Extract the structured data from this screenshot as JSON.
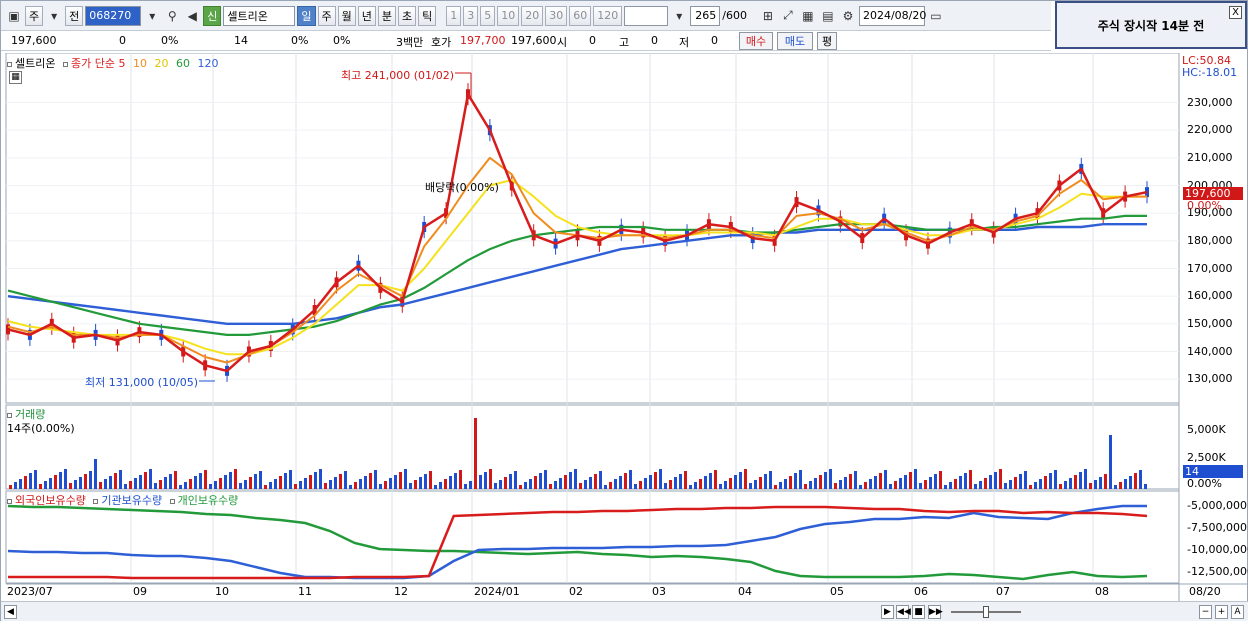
{
  "toolbar": {
    "menu1": "주",
    "menu2": "전",
    "code": "068270",
    "new_badge": "신",
    "stock_name": "셀트리온",
    "periods": [
      "일",
      "주",
      "월",
      "년",
      "분",
      "초",
      "틱"
    ],
    "intervals": [
      "1",
      "3",
      "5",
      "10",
      "20",
      "30",
      "60",
      "120"
    ],
    "count": "265",
    "count_max": "/600",
    "date": "2024/08/20"
  },
  "alert": {
    "text": "주식 장시작 14분 전",
    "close": "X"
  },
  "quote": {
    "price": "197,600",
    "change": "0",
    "change_pct": "0%",
    "volume": "14",
    "vol_pct1": "0%",
    "vol_pct2": "0%",
    "amount": "3백만",
    "ask_label": "호가",
    "ask": "197,700",
    "bid": "197,600",
    "open_label": "시",
    "open": "0",
    "high_label": "고",
    "high": "0",
    "low_label": "저",
    "low": "0",
    "buy": "매수",
    "sell": "매도",
    "eval": "평"
  },
  "chart_legend": {
    "stock": "셀트리온",
    "ma_label": "종가 단순",
    "ma5": "5",
    "ma10": "10",
    "ma20": "20",
    "ma60": "60",
    "ma120": "120",
    "lc": "LC:50.84",
    "hc": "HC:-18.01"
  },
  "annotations": {
    "high": "최고 241,000 (01/02)",
    "low": "최저 131,000 (10/05)",
    "dividend": "배당락(0.00%)"
  },
  "price_axis": [
    "230,000",
    "220,000",
    "210,000",
    "200,000",
    "190,000",
    "180,000",
    "170,000",
    "160,000",
    "150,000",
    "140,000",
    "130,000"
  ],
  "current_price_tag": "197,600",
  "current_pct_tag": "0.00%",
  "volume_panel": {
    "title": "거래량",
    "value": "14주(0.00%)",
    "axis": [
      "5,000K",
      "2,500K",
      "0.00%"
    ],
    "current": "14"
  },
  "holdings_panel": {
    "series": [
      "외국인보유수량",
      "기관보유수량",
      "개인보유수량"
    ],
    "axis": [
      "-5,000,000",
      "-7,500,000",
      "-10,000,000",
      "-12,500,000"
    ]
  },
  "date_axis": [
    "2023/07",
    "09",
    "10",
    "11",
    "12",
    "2024/01",
    "02",
    "03",
    "04",
    "05",
    "06",
    "07",
    "08",
    "08/20"
  ],
  "colors": {
    "ma5": "#d81c1c",
    "ma10": "#f08c1e",
    "ma20": "#f5e11c",
    "ma60": "#229a3a",
    "ma120": "#2f5fd6",
    "up": "#d01818",
    "down": "#1f4fd0"
  },
  "chart_data": [
    {
      "type": "line",
      "title": "셀트리온",
      "series": [
        {
          "name": "5",
          "values": [
            148000,
            146000,
            150000,
            145000,
            146000,
            144000,
            147000,
            146000,
            140000,
            135000,
            133000,
            140000,
            142000,
            148000,
            155000,
            165000,
            171000,
            163000,
            158000,
            185000,
            190000,
            233000,
            220000,
            200000,
            182000,
            179000,
            182000,
            180000,
            184000,
            183000,
            180000,
            182000,
            186000,
            185000,
            181000,
            180000,
            194000,
            191000,
            187000,
            181000,
            188000,
            182000,
            179000,
            183000,
            186000,
            183000,
            188000,
            190000,
            200000,
            206000,
            190000,
            196000,
            197600
          ]
        },
        {
          "name": "10",
          "values": [
            149000,
            147000,
            149000,
            146000,
            146000,
            145000,
            146000,
            146000,
            142000,
            138000,
            136000,
            139000,
            142000,
            147000,
            153000,
            162000,
            168000,
            164000,
            160000,
            178000,
            188000,
            200000,
            210000,
            204000,
            190000,
            183000,
            182000,
            181000,
            182000,
            182000,
            181000,
            182000,
            184000,
            184000,
            182000,
            181000,
            189000,
            190000,
            188000,
            184000,
            186000,
            183000,
            180000,
            182000,
            185000,
            184000,
            187000,
            189000,
            197000,
            202000,
            195000,
            196000,
            196000
          ]
        },
        {
          "name": "20",
          "values": [
            151000,
            149000,
            148000,
            147000,
            146000,
            146000,
            146000,
            146000,
            144000,
            141000,
            139000,
            139000,
            141000,
            145000,
            150000,
            157000,
            164000,
            164000,
            162000,
            170000,
            180000,
            190000,
            200000,
            202000,
            196000,
            189000,
            185000,
            183000,
            182000,
            182000,
            182000,
            182000,
            183000,
            183000,
            183000,
            182000,
            185000,
            188000,
            188000,
            186000,
            186000,
            184000,
            182000,
            182000,
            184000,
            184000,
            186000,
            188000,
            192000,
            197000,
            196000,
            196000,
            196000
          ]
        },
        {
          "name": "60",
          "values": [
            162000,
            160000,
            158000,
            156000,
            154000,
            152000,
            150000,
            149000,
            148000,
            147000,
            146000,
            146000,
            147000,
            148000,
            149000,
            151000,
            154000,
            157000,
            159000,
            163000,
            168000,
            173000,
            177000,
            180000,
            182000,
            183000,
            184000,
            185000,
            185000,
            185000,
            184000,
            184000,
            184000,
            184000,
            183000,
            183000,
            184000,
            185000,
            186000,
            186000,
            186000,
            185000,
            184000,
            184000,
            184000,
            185000,
            185000,
            186000,
            187000,
            188000,
            188000,
            189000,
            189000
          ]
        },
        {
          "name": "120",
          "values": [
            160000,
            159000,
            158000,
            157000,
            156000,
            155000,
            154000,
            153000,
            152000,
            151000,
            150000,
            150000,
            150000,
            150000,
            151000,
            152000,
            154000,
            156000,
            157000,
            159000,
            161000,
            163000,
            165000,
            167000,
            169000,
            171000,
            173000,
            175000,
            177000,
            178000,
            179000,
            180000,
            181000,
            182000,
            182000,
            183000,
            183000,
            184000,
            184000,
            184000,
            184000,
            184000,
            184000,
            184000,
            184000,
            184000,
            184000,
            185000,
            185000,
            185000,
            186000,
            186000,
            186000
          ]
        }
      ],
      "ylim": [
        125000,
        245000
      ],
      "ylabel": ""
    }
  ]
}
